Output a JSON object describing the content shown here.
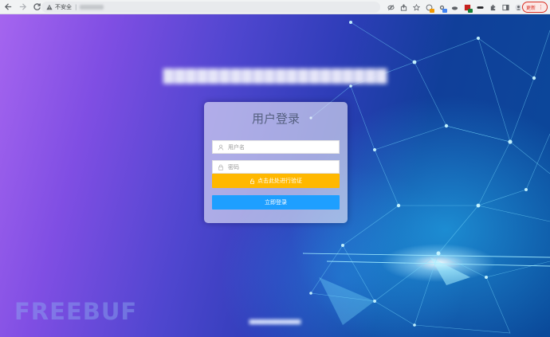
{
  "browser": {
    "address_bar": {
      "security_label": "不安全",
      "separator": "|"
    },
    "update_button": "更新"
  },
  "page": {
    "login": {
      "title": "用户登录",
      "username_placeholder": "用户名",
      "password_placeholder": "密码",
      "verify_button": "点击此处进行验证",
      "submit_button": "立即登录"
    },
    "watermark": "FREEBUF"
  },
  "colors": {
    "verify_button": "#ffb800",
    "submit_button": "#1e9fff",
    "update_button": "#d93025"
  }
}
